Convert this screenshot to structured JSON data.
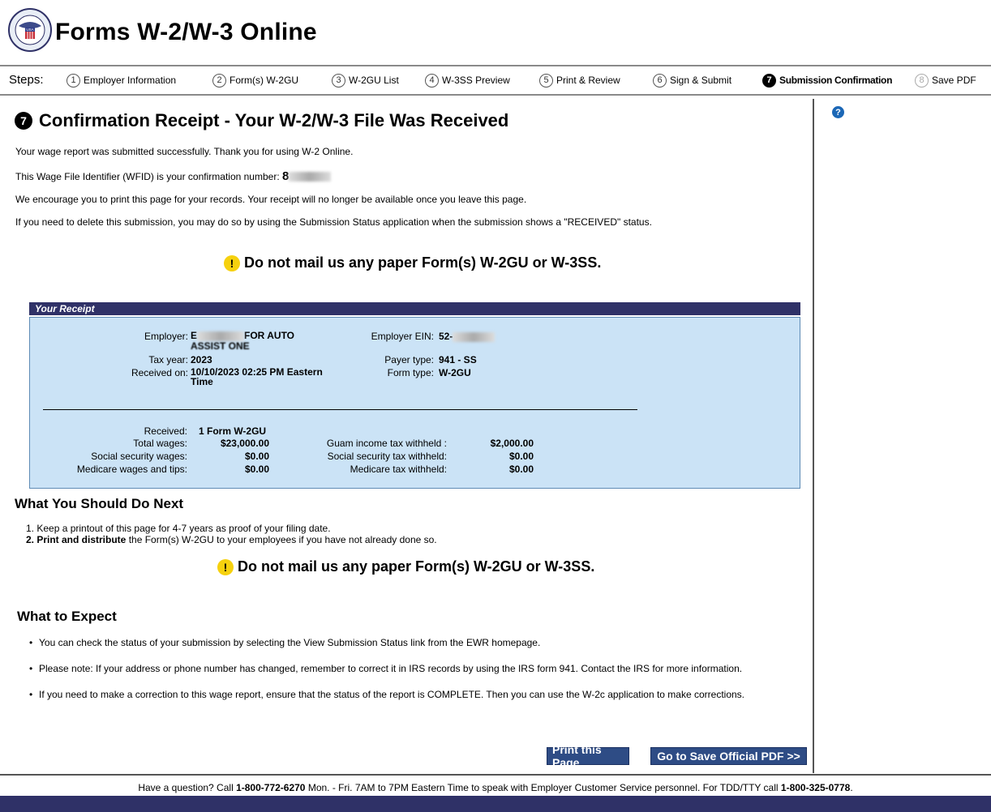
{
  "header": {
    "title": "Forms W-2/W-3 Online",
    "seal_text": "USA"
  },
  "steps": {
    "label": "Steps:",
    "items": [
      {
        "num": "1",
        "label": "Employer Information",
        "state": "done"
      },
      {
        "num": "2",
        "label": "Form(s) W-2GU",
        "state": "done"
      },
      {
        "num": "3",
        "label": "W-2GU List",
        "state": "done"
      },
      {
        "num": "4",
        "label": "W-3SS Preview",
        "state": "done"
      },
      {
        "num": "5",
        "label": "Print & Review",
        "state": "done"
      },
      {
        "num": "6",
        "label": "Sign & Submit",
        "state": "done"
      },
      {
        "num": "7",
        "label": "Submission Confirmation",
        "state": "active"
      },
      {
        "num": "8",
        "label": "Save PDF",
        "state": "disabled"
      }
    ]
  },
  "help": {
    "icon": "?"
  },
  "confirmation": {
    "step_num": "7",
    "heading": "Confirmation Receipt - Your W-2/W-3 File Was Received",
    "line1": "Your wage report was submitted successfully.  Thank you for using W-2 Online.",
    "line2_prefix": "This Wage File Identifier (WFID) is your confirmation number: ",
    "wfid_visible": "8",
    "line3": "We encourage you to print this page for your records. Your receipt will no longer be available once you leave this page.",
    "line4": "If you need to delete this submission, you may do so by using the Submission Status application when the submission shows a \"RECEIVED\" status.",
    "warning": "Do not mail us any paper Form(s) W-2GU or W-3SS."
  },
  "receipt": {
    "title": "Your Receipt",
    "employer_label": "Employer:",
    "employer_value_start": "E",
    "employer_value_end": "FOR AUTO",
    "employer_value_line2": "ASSIST ONE",
    "ein_label": "Employer EIN:",
    "ein_value_start": "52-",
    "tax_year_label": "Tax year:",
    "tax_year": "2023",
    "payer_type_label": "Payer type:",
    "payer_type": "941 - SS",
    "received_on_label": "Received on:",
    "received_on": "10/10/2023 02:25 PM Eastern",
    "received_on_line2": "Time",
    "form_type_label": "Form type:",
    "form_type": "W-2GU",
    "received_label": "Received:",
    "received_value": "1 Form W-2GU",
    "total_wages_label": "Total wages:",
    "total_wages": "$23,000.00",
    "ss_wages_label": "Social security wages:",
    "ss_wages": "$0.00",
    "medicare_wages_label": "Medicare wages and tips:",
    "medicare_wages": "$0.00",
    "guam_tax_label": "Guam income tax withheld :",
    "guam_tax": "$2,000.00",
    "ss_tax_label": "Social security tax withheld:",
    "ss_tax": "$0.00",
    "medicare_tax_label": "Medicare tax withheld:",
    "medicare_tax": "$0.00"
  },
  "next": {
    "heading": "What You Should Do Next",
    "item1": "1. Keep a printout of this page for 4-7 years as proof of your filing date.",
    "item2_bold": "2. Print and distribute",
    "item2_rest": " the Form(s) W-2GU to your employees if you have not already done so."
  },
  "expect": {
    "heading": "What to Expect",
    "items": [
      "You can check the status of your submission by selecting the View Submission Status link from the EWR homepage.",
      "Please note: If your address or phone number has changed, remember to correct it in IRS records by using the IRS form 941. Contact the IRS for more information.",
      "If you need to make a correction to this wage report, ensure that the status of the report is COMPLETE. Then you can use the W-2c application to make corrections."
    ]
  },
  "buttons": {
    "print": "Print this Page",
    "save_pdf": "Go to Save Official PDF >>"
  },
  "footer": {
    "t1": "Have a question? Call ",
    "phone1": "1-800-772-6270",
    "t2": " Mon. - Fri. 7AM to 7PM Eastern Time to speak with Employer Customer Service personnel. For TDD/TTY call ",
    "phone2": "1-800-325-0778",
    "t3": "."
  },
  "colors": {
    "navy": "#2f3167",
    "receipt_bg": "#cbe3f6",
    "button": "#2e4c85",
    "help": "#1b67b6",
    "warning": "#f6d10e"
  }
}
